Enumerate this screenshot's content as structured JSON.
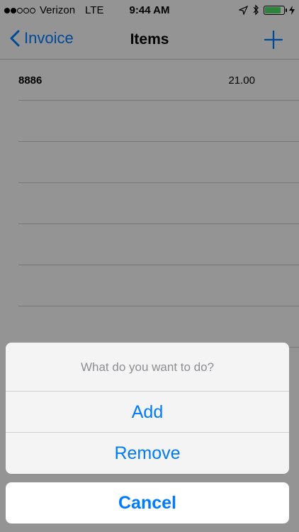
{
  "status_bar": {
    "carrier": "Verizon",
    "network": "LTE",
    "time": "9:44 AM",
    "signal_bars": 2,
    "battery_level": 0.85,
    "icons": [
      "location-icon",
      "bluetooth-icon",
      "battery-icon",
      "charging-icon"
    ]
  },
  "nav": {
    "back_label": "Invoice",
    "title": "Items",
    "add_icon": "plus-icon"
  },
  "items": [
    {
      "code": "8886",
      "amount": "21.00"
    },
    {
      "code": "",
      "amount": ""
    },
    {
      "code": "",
      "amount": ""
    },
    {
      "code": "",
      "amount": ""
    },
    {
      "code": "",
      "amount": ""
    },
    {
      "code": "",
      "amount": ""
    },
    {
      "code": "",
      "amount": ""
    }
  ],
  "action_sheet": {
    "title": "What do you want to do?",
    "options": [
      "Add",
      "Remove"
    ],
    "cancel_label": "Cancel"
  },
  "colors": {
    "accent": "#007aff",
    "battery": "#4cd964",
    "separator": "#c8c7cc",
    "muted_text": "#8e8e93"
  }
}
